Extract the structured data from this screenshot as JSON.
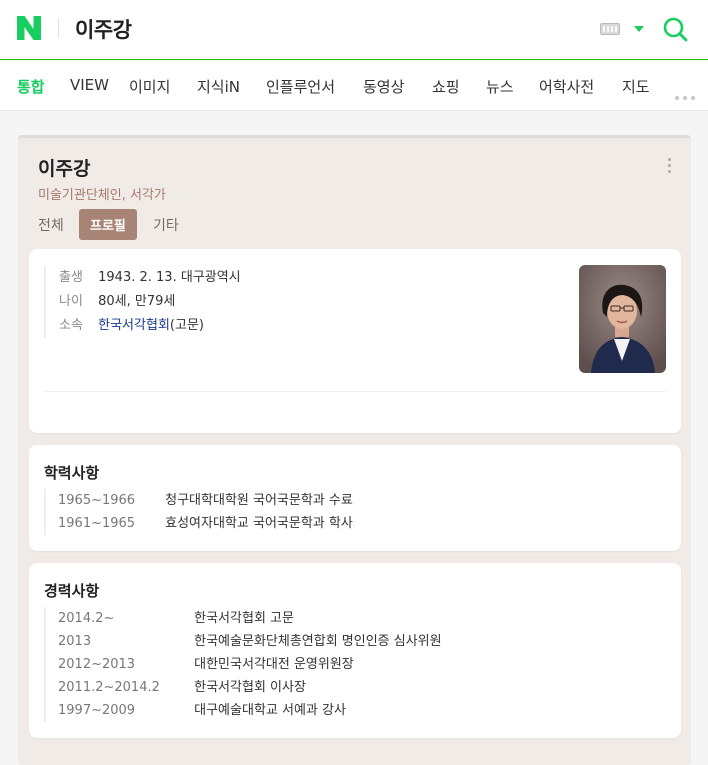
{
  "header": {
    "logo_letter": "N",
    "query": "이주강",
    "brand_color": "#19ce60"
  },
  "tabs": [
    {
      "label": "통합",
      "active": true
    },
    {
      "label": "VIEW"
    },
    {
      "label": "이미지"
    },
    {
      "label": "지식iN"
    },
    {
      "label": "인플루언서"
    },
    {
      "label": "동영상"
    },
    {
      "label": "쇼핑"
    },
    {
      "label": "뉴스"
    },
    {
      "label": "어학사전"
    },
    {
      "label": "지도"
    }
  ],
  "profile": {
    "name": "이주강",
    "subtitle": "미술기관단체인, 서각가",
    "tabs": [
      {
        "label": "전체"
      },
      {
        "label": "프로필",
        "active": true
      },
      {
        "label": "기타"
      }
    ],
    "info": [
      {
        "label": "출생",
        "value": "1943. 2. 13. 대구광역시"
      },
      {
        "label": "나이",
        "value": "80세, 만79세"
      },
      {
        "label": "소속",
        "link": "한국서각협회",
        "suffix": "(고문)"
      }
    ]
  },
  "education": {
    "title": "학력사항",
    "items": [
      {
        "years": "1965~1966",
        "desc": "청구대학대학원 국어국문학과 수료"
      },
      {
        "years": "1961~1965",
        "desc": "효성여자대학교 국어국문학과 학사"
      }
    ]
  },
  "career": {
    "title": "경력사항",
    "items": [
      {
        "years": "2014.2~",
        "desc": "한국서각협회 고문"
      },
      {
        "years": "2013",
        "desc": "한국예술문화단체총연합회 명인인증 심사위원"
      },
      {
        "years": "2012~2013",
        "desc": "대한민국서각대전 운영위원장"
      },
      {
        "years": "2011.2~2014.2",
        "desc": "한국서각협회 이사장"
      },
      {
        "years": "1997~2009",
        "desc": "대구예술대학교 서예과 강사"
      }
    ]
  }
}
